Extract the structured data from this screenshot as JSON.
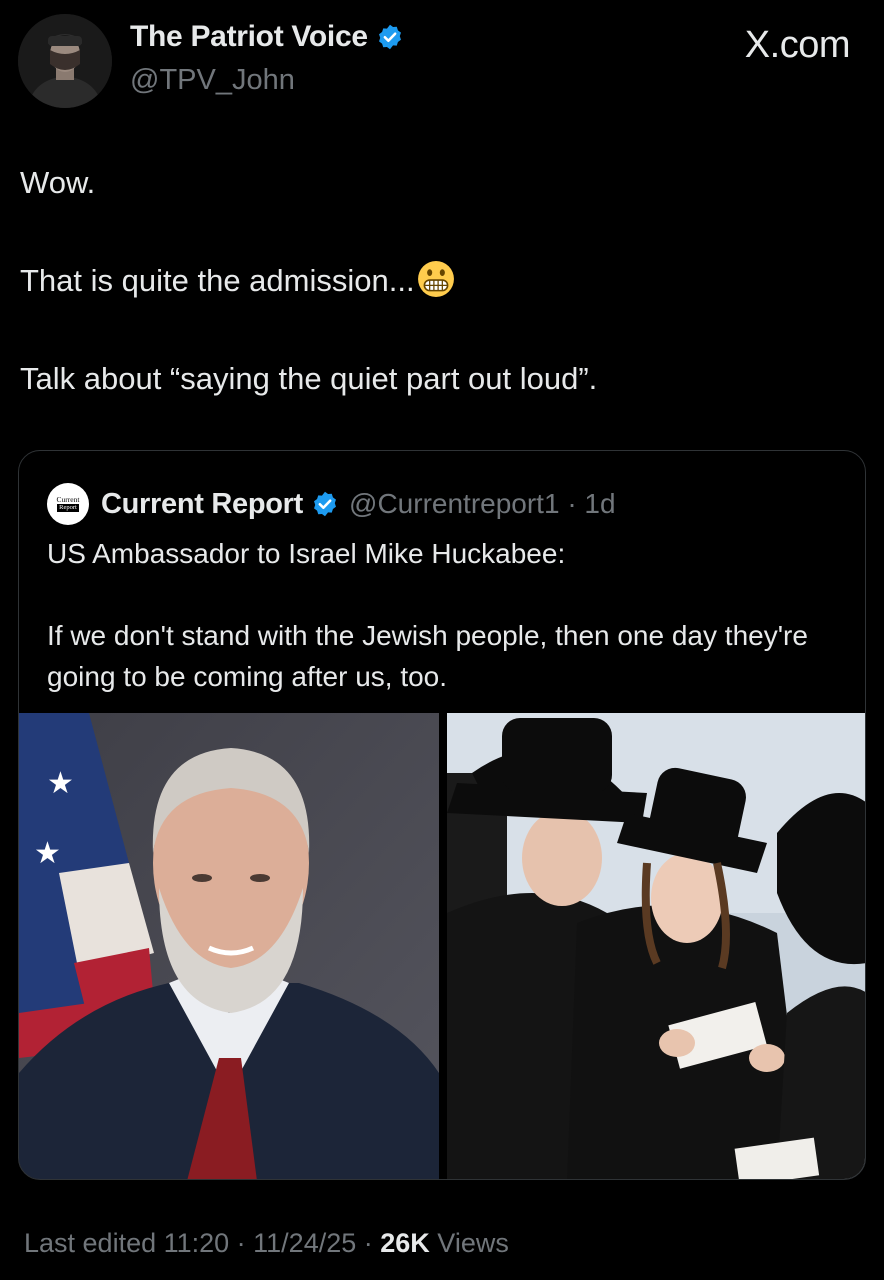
{
  "author": {
    "display_name": "The Patriot Voice",
    "handle": "@TPV_John",
    "verified": true,
    "avatar_icon": "profile-photo"
  },
  "brand": "X.com",
  "tweet": {
    "line1": "Wow.",
    "line2": "That is quite the admission...",
    "emoji": "grimacing-face-emoji",
    "line3": "Talk about “saying the quiet part out loud”."
  },
  "quoted": {
    "logo_top": "Current",
    "logo_bottom": "Report",
    "display_name": "Current Report",
    "handle_time": "@Currentreport1 · 1d",
    "text_line1": "US Ambassador to Israel Mike Huckabee:",
    "text_line2": "If we don't stand with the Jewish people, then one day they're going to be coming after us, too.",
    "media": [
      {
        "icon": "portrait-photo"
      },
      {
        "icon": "group-photo"
      }
    ]
  },
  "meta": {
    "edited": "Last edited 11:20 · 11/24/25",
    "sep": " · ",
    "views_count": "26K",
    "views_label": " Views"
  },
  "colors": {
    "background": "#000000",
    "text": "#e7e9ea",
    "secondary": "#71767b",
    "verified_blue": "#1d9bf0",
    "border": "#2f3336"
  }
}
